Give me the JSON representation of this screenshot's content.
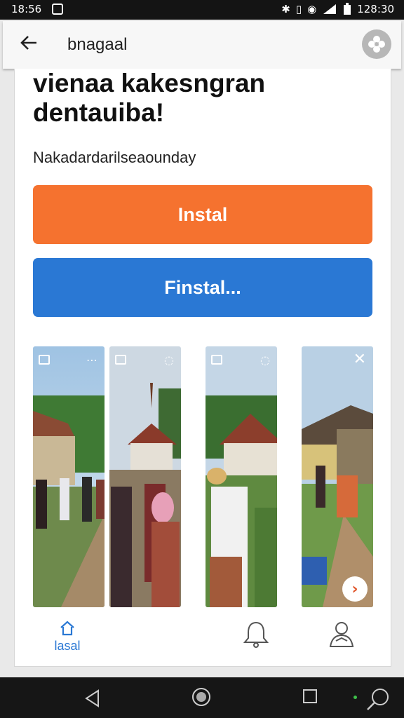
{
  "status_bar": {
    "time_left": "18:56",
    "time_right": "128:30"
  },
  "top_bar": {
    "title": "bnagaal"
  },
  "headline": "vienaa kakesngran dentauiba!",
  "subtitle": "Nakadardarilseaounday",
  "buttons": {
    "primary_label": "Instal",
    "secondary_label": "Finstal..."
  },
  "bottom_nav": {
    "home_label": "lasal"
  },
  "colors": {
    "orange": "#f5722f",
    "blue": "#2a78d4"
  },
  "icons": [
    "back-arrow-icon",
    "settings-icon",
    "home-icon",
    "bell-icon",
    "profile-icon"
  ]
}
